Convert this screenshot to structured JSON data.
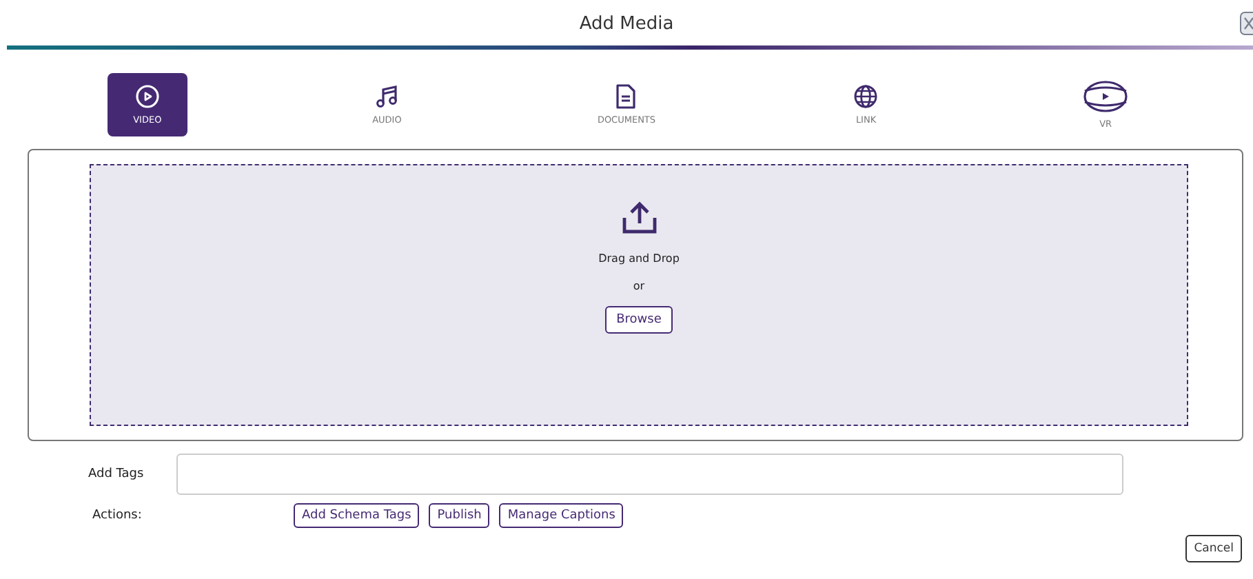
{
  "window": {
    "title": "Add Media"
  },
  "tabs": [
    {
      "label": "VIDEO",
      "kind": "video",
      "selected": true
    },
    {
      "label": "AUDIO",
      "kind": "audio",
      "selected": false
    },
    {
      "label": "DOCUMENTS",
      "kind": "document",
      "selected": false
    },
    {
      "label": "LINK",
      "kind": "link",
      "selected": false
    },
    {
      "label": "VR",
      "kind": "vr",
      "selected": false
    }
  ],
  "dropzone": {
    "text": "Drag and Drop",
    "separator": "or",
    "button": "Browse"
  },
  "tags": {
    "label": "Add Tags"
  },
  "actions": {
    "label": "Actions:",
    "buttons": [
      "Add Schema Tags",
      "Publish",
      "Manage Captions"
    ]
  },
  "footer": {
    "button": "Cancel"
  }
}
